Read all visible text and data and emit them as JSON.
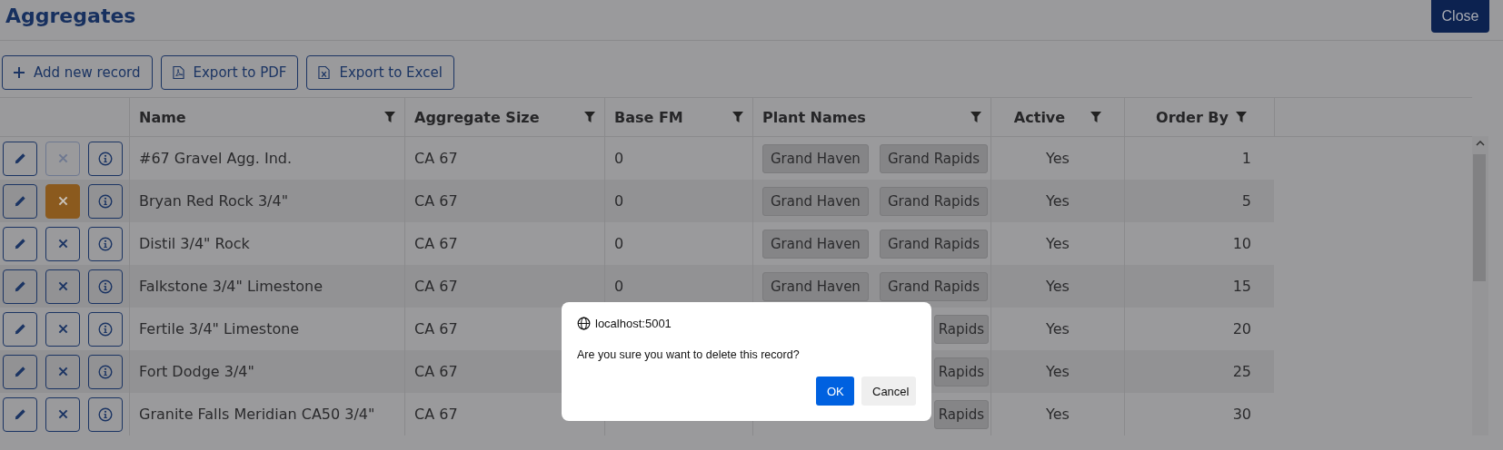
{
  "title": "Aggregates",
  "close_button": "Close",
  "toolbar": [
    {
      "kind": "add",
      "label": "Add new record"
    },
    {
      "kind": "pdf",
      "label": "Export to PDF"
    },
    {
      "kind": "excel",
      "label": "Export to Excel"
    }
  ],
  "table": {
    "columns": [
      {
        "label": "Name",
        "kind": "text"
      },
      {
        "label": "Aggregate Size",
        "kind": "text"
      },
      {
        "label": "Base FM",
        "kind": "text"
      },
      {
        "label": "Plant Names",
        "kind": "tags"
      },
      {
        "label": "Active",
        "kind": "flag"
      },
      {
        "label": "Order By",
        "kind": "number"
      }
    ],
    "rows": [
      {
        "delete_disabled": true,
        "delete_pressed": false,
        "cells": [
          "#67 Gravel Agg. Ind.",
          "CA 67",
          "0",
          [
            "Grand Haven",
            "Grand Rapids"
          ],
          "Yes",
          "1"
        ]
      },
      {
        "delete_disabled": false,
        "delete_pressed": true,
        "cells": [
          "Bryan Red Rock 3/4\"",
          "CA 67",
          "0",
          [
            "Grand Haven",
            "Grand Rapids"
          ],
          "Yes",
          "5"
        ]
      },
      {
        "delete_disabled": false,
        "delete_pressed": false,
        "cells": [
          "Distil 3/4\" Rock",
          "CA 67",
          "0",
          [
            "Grand Haven",
            "Grand Rapids"
          ],
          "Yes",
          "10"
        ]
      },
      {
        "delete_disabled": false,
        "delete_pressed": false,
        "cells": [
          "Falkstone 3/4\" Limestone",
          "CA 67",
          "0",
          [
            "Grand Haven",
            "Grand Rapids"
          ],
          "Yes",
          "15"
        ]
      },
      {
        "delete_disabled": false,
        "delete_pressed": false,
        "cells": [
          "Fertile 3/4\" Limestone",
          "CA 67",
          null,
          [
            "Rapids"
          ],
          "Yes",
          "20"
        ]
      },
      {
        "delete_disabled": false,
        "delete_pressed": false,
        "cells": [
          "Fort Dodge 3/4\"",
          "CA 67",
          null,
          [
            "Rapids"
          ],
          "Yes",
          "25"
        ]
      },
      {
        "delete_disabled": false,
        "delete_pressed": false,
        "cells": [
          "Granite Falls Meridian CA50 3/4\"",
          "CA 67",
          null,
          [
            "Rapids"
          ],
          "Yes",
          "30"
        ]
      }
    ]
  },
  "dialog": {
    "origin": "localhost:5001",
    "message": "Are you sure you want to delete this record?",
    "buttons": [
      {
        "label": "OK",
        "kind": "primary"
      },
      {
        "label": "Cancel",
        "kind": "secondary"
      }
    ]
  }
}
